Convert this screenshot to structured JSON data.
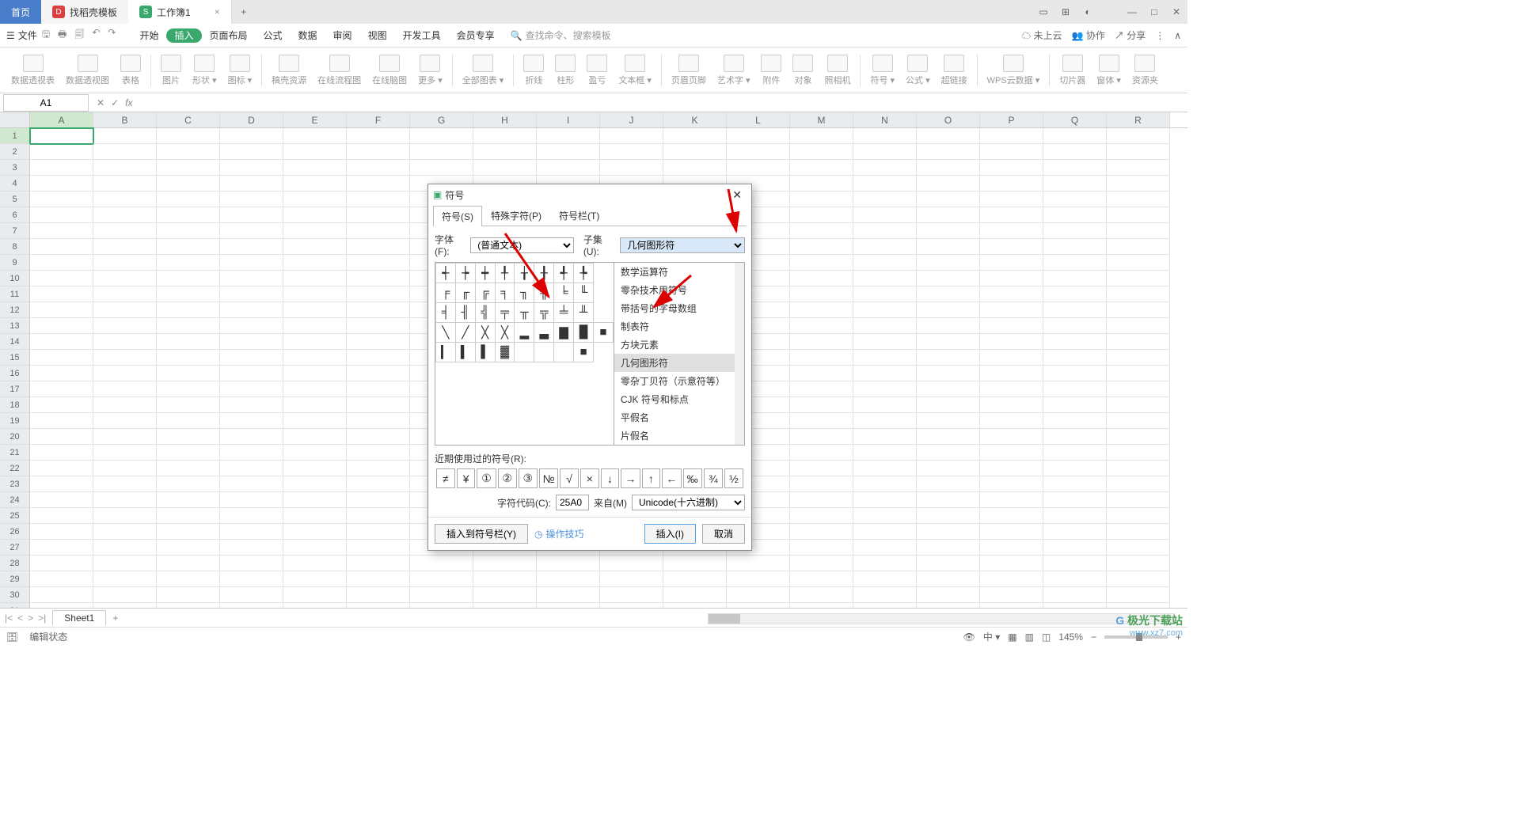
{
  "titlebar": {
    "home": "首页",
    "doc_tab": "找稻壳模板",
    "workbook_tab": "工作簿1",
    "add": "+"
  },
  "menu": {
    "file": "文件",
    "tabs": [
      "开始",
      "插入",
      "页面布局",
      "公式",
      "数据",
      "审阅",
      "视图",
      "开发工具",
      "会员专享"
    ],
    "active_idx": 1,
    "search_ph": "查找命令、搜索模板",
    "cloud": "未上云",
    "coop": "协作",
    "share": "分享"
  },
  "ribbon": {
    "groups": [
      "数据透视表",
      "数据透视图",
      "表格",
      "图片",
      "形状",
      "图标",
      "稿壳资源",
      "在线流程图",
      "在线脑图",
      "更多",
      "全部图表",
      "折线",
      "柱形",
      "盈亏",
      "文本框",
      "页眉页脚",
      "艺术字",
      "附件",
      "对象",
      "照相机",
      "符号",
      "公式",
      "超链接",
      "WPS云数据",
      "切片器",
      "窗体",
      "资源夹"
    ]
  },
  "cellref": "A1",
  "cols": [
    "A",
    "B",
    "C",
    "D",
    "E",
    "F",
    "G",
    "H",
    "I",
    "J",
    "K",
    "L",
    "M",
    "N",
    "O",
    "P",
    "Q",
    "R"
  ],
  "dialog": {
    "title": "符号",
    "tabs": [
      "符号(S)",
      "特殊字符(P)",
      "符号栏(T)"
    ],
    "font_lbl": "字体(F):",
    "font_val": "(普通文本)",
    "subset_lbl": "子集(U):",
    "subset_val": "几何图形符",
    "dd_items": [
      "数学运算符",
      "零杂技术用符号",
      "带括号的字母数组",
      "制表符",
      "方块元素",
      "几何图形符",
      "零杂丁贝符（示意符等）",
      "CJK 符号和标点",
      "平假名",
      "片假名"
    ],
    "dd_hl_idx": 5,
    "symgrid": [
      [
        "┽",
        "┾",
        "┿",
        "╀",
        "╁",
        "╂",
        "╃",
        "╄"
      ],
      [
        "╒",
        "╓",
        "╔",
        "╕",
        "╖",
        "╗",
        "╘",
        "╙"
      ],
      [
        "╡",
        "╢",
        "╣",
        "╤",
        "╥",
        "╦",
        "╧",
        "╨"
      ],
      [
        "╲",
        "╱",
        "╳",
        "╳",
        "▂",
        "▃",
        "▇",
        "█",
        "■"
      ],
      [
        "▎",
        "▍",
        "▌",
        "▓",
        "",
        "",
        "",
        "■"
      ]
    ],
    "recent_lbl": "近期使用过的符号(R):",
    "recent": [
      "≠",
      "¥",
      "①",
      "②",
      "③",
      "№",
      "√",
      "×",
      "↓",
      "→",
      "↑",
      "←",
      "‰",
      "¾",
      "½"
    ],
    "code_lbl": "字符代码(C):",
    "code_val": "25A0",
    "from_lbl": "来自(M)",
    "from_val": "Unicode(十六进制)",
    "insert_bar": "插入到符号栏(Y)",
    "tips": "操作技巧",
    "insert_btn": "插入(I)",
    "cancel_btn": "取消"
  },
  "sheet": {
    "name": "Sheet1",
    "add": "+"
  },
  "status": {
    "mode": "编辑状态",
    "zoom": "145%"
  },
  "wm": {
    "l1": "极光下载站",
    "l2": "www.xz7.com"
  }
}
